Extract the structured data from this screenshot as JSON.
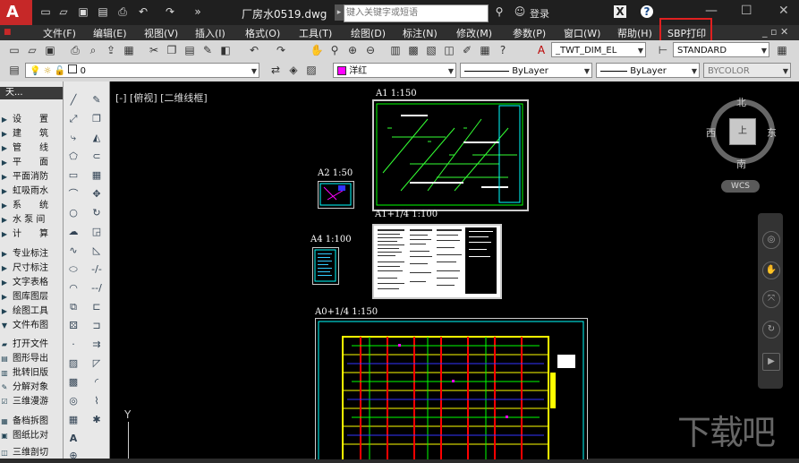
{
  "window": {
    "file_title": "厂房水0519.dwg",
    "search_placeholder": "键入关键字或短语",
    "login_label": "登录",
    "help_label": "?"
  },
  "menu": {
    "items": [
      "文件(F)",
      "编辑(E)",
      "视图(V)",
      "插入(I)",
      "格式(O)",
      "工具(T)",
      "绘图(D)",
      "标注(N)",
      "修改(M)",
      "参数(P)",
      "窗口(W)",
      "帮助(H)",
      "SBP打印"
    ],
    "highlight_color": "#e02020"
  },
  "toolbar1": {
    "text_style": "_TWT_DIM_EL",
    "dim_style": "STANDARD"
  },
  "toolbar2": {
    "layer": "0",
    "color": "洋红",
    "color_swatch": "#ff00ff",
    "linetype": "ByLayer",
    "lineweight": "ByLayer",
    "plotstyle": "BYCOLOR"
  },
  "side_panel": {
    "title": "天...",
    "items": [
      "设　　置",
      "建　　筑",
      "管　　线",
      "平　　面",
      "平面消防",
      "虹吸雨水",
      "系　　统",
      "水 泵 间",
      "计　　算",
      "专业标注",
      "尺寸标注",
      "文字表格",
      "图库图层",
      "绘图工具",
      "文件布图"
    ],
    "bottom_items": [
      "打开文件",
      "图形导出",
      "批转旧版",
      "分解对象",
      "三维漫游",
      "备档拆图",
      "图纸比对",
      "三维剖切"
    ]
  },
  "canvas": {
    "view_label": "[-] [俯视] [二维线框]",
    "sheets": [
      "A1 1:150",
      "A2 1:50",
      "A1+1/4 1:100",
      "A4 1:100",
      "A0+1/4 1:150"
    ],
    "compass": {
      "n": "北",
      "s": "南",
      "e": "东",
      "w": "西",
      "face": "上"
    },
    "wcs": "WCS",
    "ucs_y": "Y",
    "watermark": "下载吧"
  }
}
